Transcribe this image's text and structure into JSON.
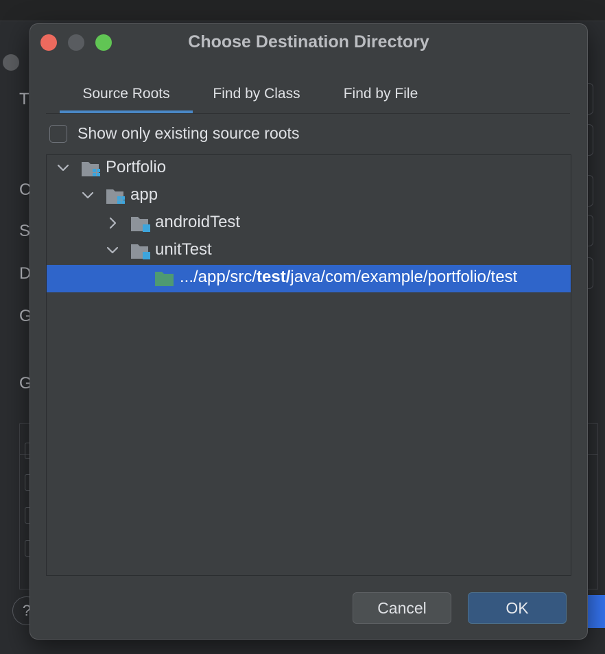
{
  "dialog": {
    "title": "Choose Destination Directory",
    "tabs": [
      {
        "label": "Source Roots",
        "active": true
      },
      {
        "label": "Find by Class",
        "active": false
      },
      {
        "label": "Find by File",
        "active": false
      }
    ],
    "checkbox": {
      "label": "Show only existing source roots",
      "checked": false
    },
    "tree": {
      "root": {
        "label": "Portfolio",
        "expanded": true,
        "icon": "module-folder-icon"
      },
      "app": {
        "label": "app",
        "expanded": true,
        "icon": "module-folder-icon"
      },
      "androidTest": {
        "label": "androidTest",
        "expanded": false,
        "icon": "test-root-folder-icon"
      },
      "unitTest": {
        "label": "unitTest",
        "expanded": true,
        "icon": "test-root-folder-icon"
      },
      "selected_path": {
        "prefix": ".../app/src/",
        "bold": "test/",
        "suffix": "java/com/example/portfolio/test",
        "icon": "test-source-folder-icon"
      }
    },
    "buttons": {
      "cancel": "Cancel",
      "ok": "OK"
    }
  },
  "background_window": {
    "visible_letters": [
      "T",
      "C",
      "S",
      "D",
      "G",
      "G"
    ],
    "help_glyph": "?"
  },
  "colors": {
    "dialog_bg": "#3C3F41",
    "selection": "#2F65CA",
    "tab_underline": "#4A88C7",
    "ok_button": "#365880",
    "folder_icon": "#8D939A",
    "source_marker": "#3DA5DC",
    "test_folder": "#4E9A72",
    "close_light": "#EC6A5E",
    "max_light": "#61C554"
  }
}
